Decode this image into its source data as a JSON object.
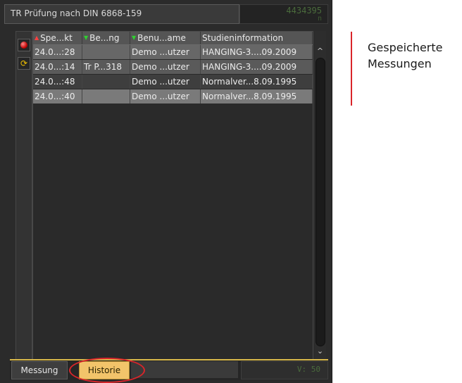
{
  "window": {
    "title": "TR Prüfung nach DIN 6868-159",
    "readout_number": "4434395",
    "readout_unit": "n"
  },
  "toolbar": {
    "tool1_icon": "red-record-icon",
    "tool2_icon": "sync-icon",
    "tool2_glyph": "⟳"
  },
  "table": {
    "headers": [
      {
        "label": "Spe...kt",
        "sort": "up"
      },
      {
        "label": "Be...ng",
        "sort": "down"
      },
      {
        "label": "Benu...ame",
        "sort": "down"
      },
      {
        "label": "Studieninformation",
        "sort": ""
      }
    ],
    "sort_up_glyph": "▲",
    "sort_down_glyph": "▼",
    "rows": [
      {
        "c1": "24.0...:28",
        "c2": "",
        "c3": "Demo ...utzer",
        "c4": "HANGING-3....09.2009"
      },
      {
        "c1": "24.0...:14",
        "c2": "Tr P...318",
        "c3": "Demo ...utzer",
        "c4": "HANGING-3....09.2009"
      },
      {
        "c1": "24.0...:48",
        "c2": "",
        "c3": "Demo ...utzer",
        "c4": "Normalver...8.09.1995"
      },
      {
        "c1": "24.0...:40",
        "c2": "",
        "c3": "Demo ...utzer",
        "c4": "Normalver...8.09.1995"
      }
    ]
  },
  "scrollbar": {
    "up": "^",
    "down": "⌄"
  },
  "tabs": {
    "messung": "Messung",
    "historie": "Historie",
    "active": "Historie",
    "readout": "V: 50"
  },
  "annotation": {
    "line1": "Gespeicherte",
    "line2": "Messungen",
    "color": "#d9252a"
  }
}
